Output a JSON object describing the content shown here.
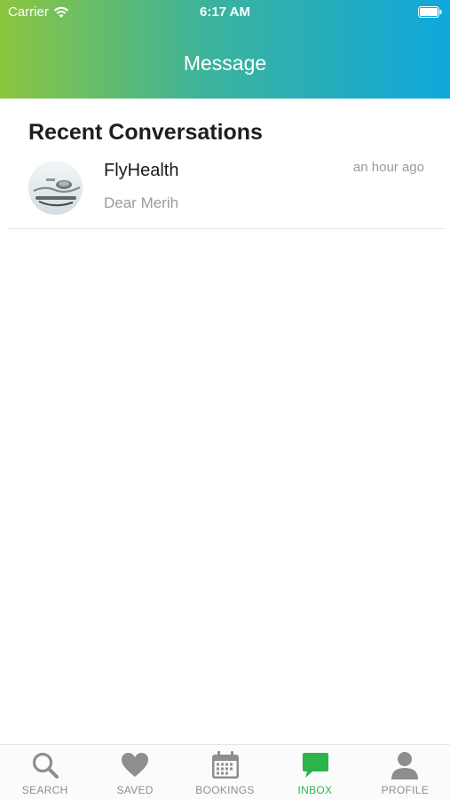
{
  "status_bar": {
    "carrier": "Carrier",
    "time": "6:17 AM"
  },
  "header": {
    "title": "Message",
    "gradient_start": "#8cc63f",
    "gradient_end": "#0fa8dd"
  },
  "section": {
    "heading": "Recent Conversations"
  },
  "conversations": [
    {
      "name": "FlyHealth",
      "preview": "Dear Merih",
      "time": "an hour ago",
      "avatar": "stethoscope-photo"
    }
  ],
  "tabbar": {
    "active_color": "#2cb34a",
    "inactive_color": "#8e8e8e",
    "tabs": [
      {
        "label": "SEARCH",
        "icon": "search-icon",
        "active": false
      },
      {
        "label": "SAVED",
        "icon": "heart-icon",
        "active": false
      },
      {
        "label": "BOOKINGS",
        "icon": "calendar-icon",
        "active": false
      },
      {
        "label": "INBOX",
        "icon": "chat-bubble-icon",
        "active": true
      },
      {
        "label": "PROFILE",
        "icon": "person-icon",
        "active": false
      }
    ]
  }
}
